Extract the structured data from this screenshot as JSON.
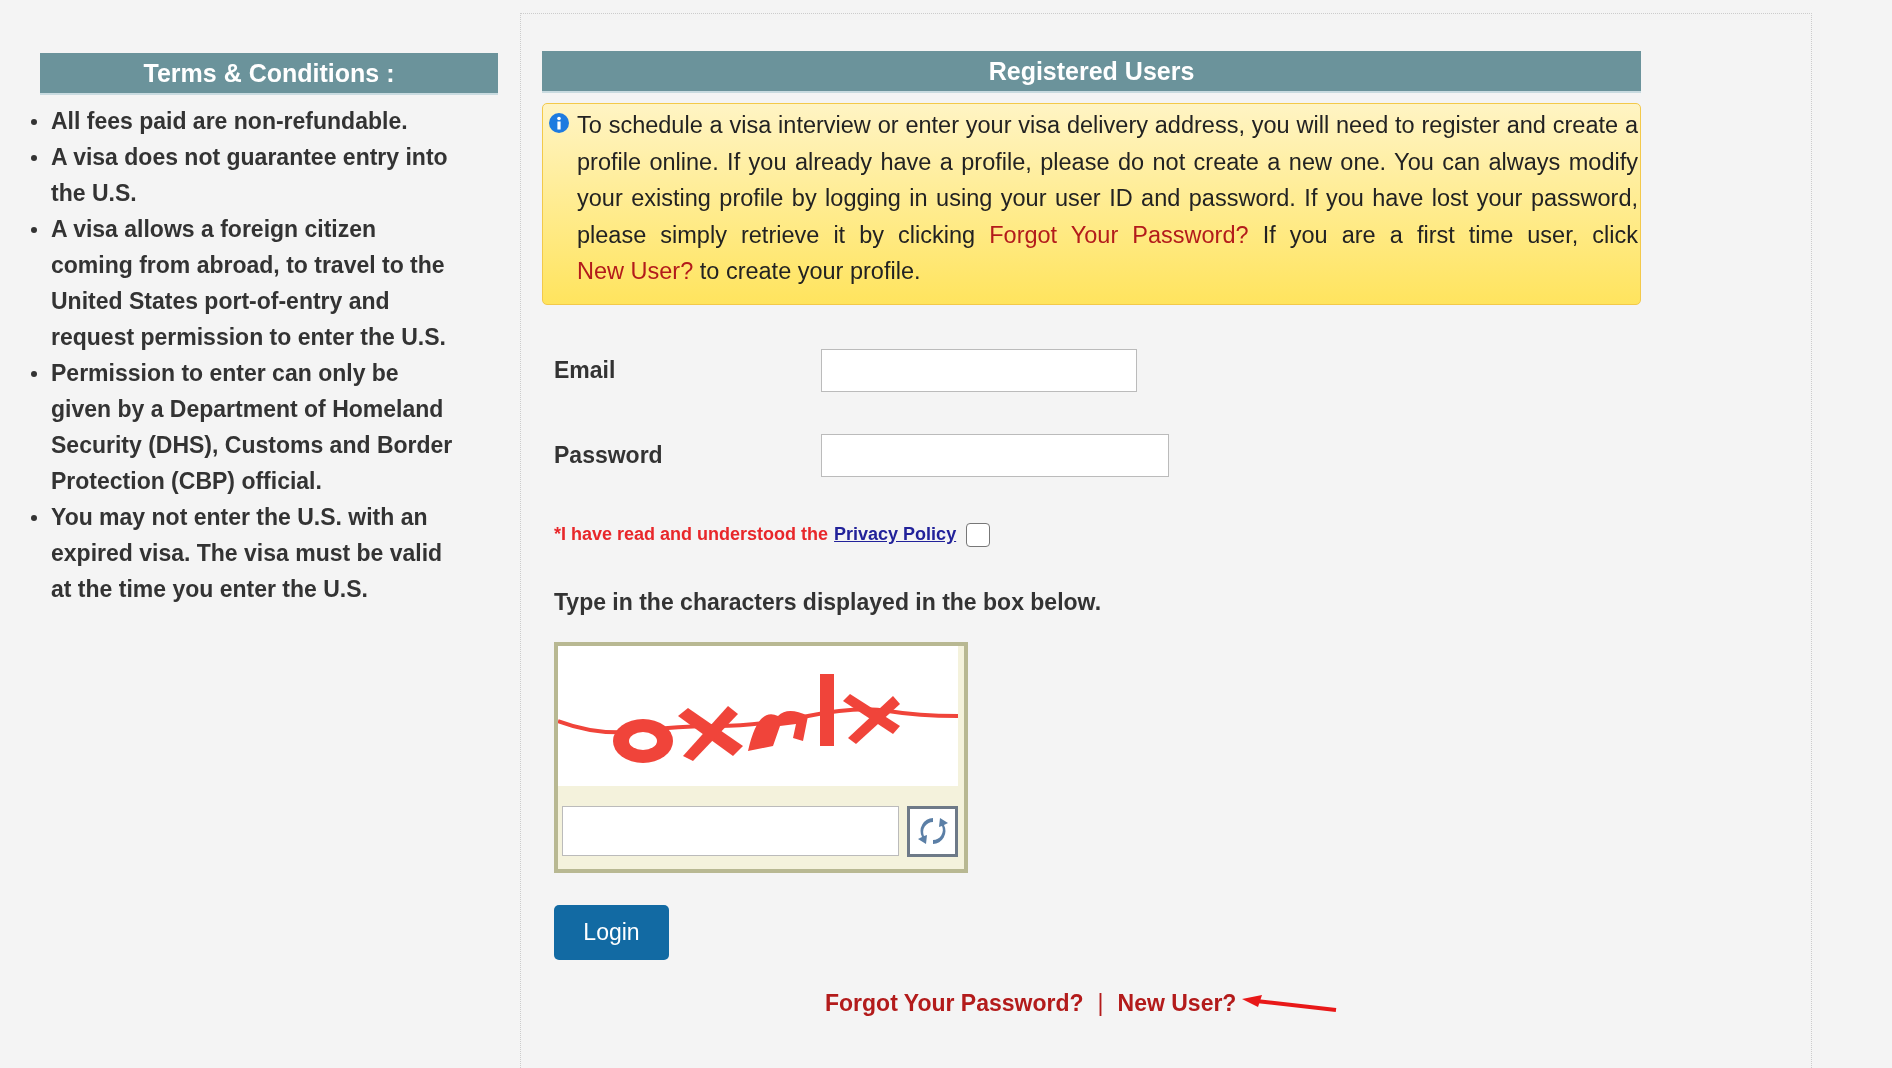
{
  "terms": {
    "title": "Terms & Conditions :",
    "items": [
      "All fees paid are non-refundable.",
      "A visa does not guarantee entry into the U.S.",
      "A visa allows a foreign citizen coming from abroad, to travel to the United States port-of-entry and request permission to enter the U.S.",
      "Permission to enter can only be given by a Department of Homeland Security (DHS), Customs and Border Protection (CBP) official.",
      "You may not enter the U.S. with an expired visa. The visa must be valid at the time you enter the U.S."
    ]
  },
  "login": {
    "title": "Registered Users",
    "notice": [
      {
        "kind": "text",
        "text": "To schedule a visa interview or enter your visa delivery address, you will need to register and create a profile online. If you already have a profile, please do not create a new one. You can always modify your existing profile by logging in using your user ID and password. If you have lost your password, please simply retrieve it by clicking "
      },
      {
        "kind": "link",
        "text": "Forgot Your Password?"
      },
      {
        "kind": "text",
        "text": " If you are a first time user, click "
      },
      {
        "kind": "link",
        "text": "New User?"
      },
      {
        "kind": "text",
        "text": " to create your profile."
      }
    ],
    "fields": [
      {
        "label": "Email",
        "kind": "email"
      },
      {
        "label": "Password",
        "kind": "password"
      }
    ],
    "privacy": {
      "text": "*I have read and understood the",
      "link": "Privacy Policy",
      "checked": false
    },
    "captcha_prompt": "Type in the characters displayed in the box below.",
    "login_button": "Login",
    "links": [
      "Forgot Your Password?",
      "|",
      "New User?"
    ]
  }
}
